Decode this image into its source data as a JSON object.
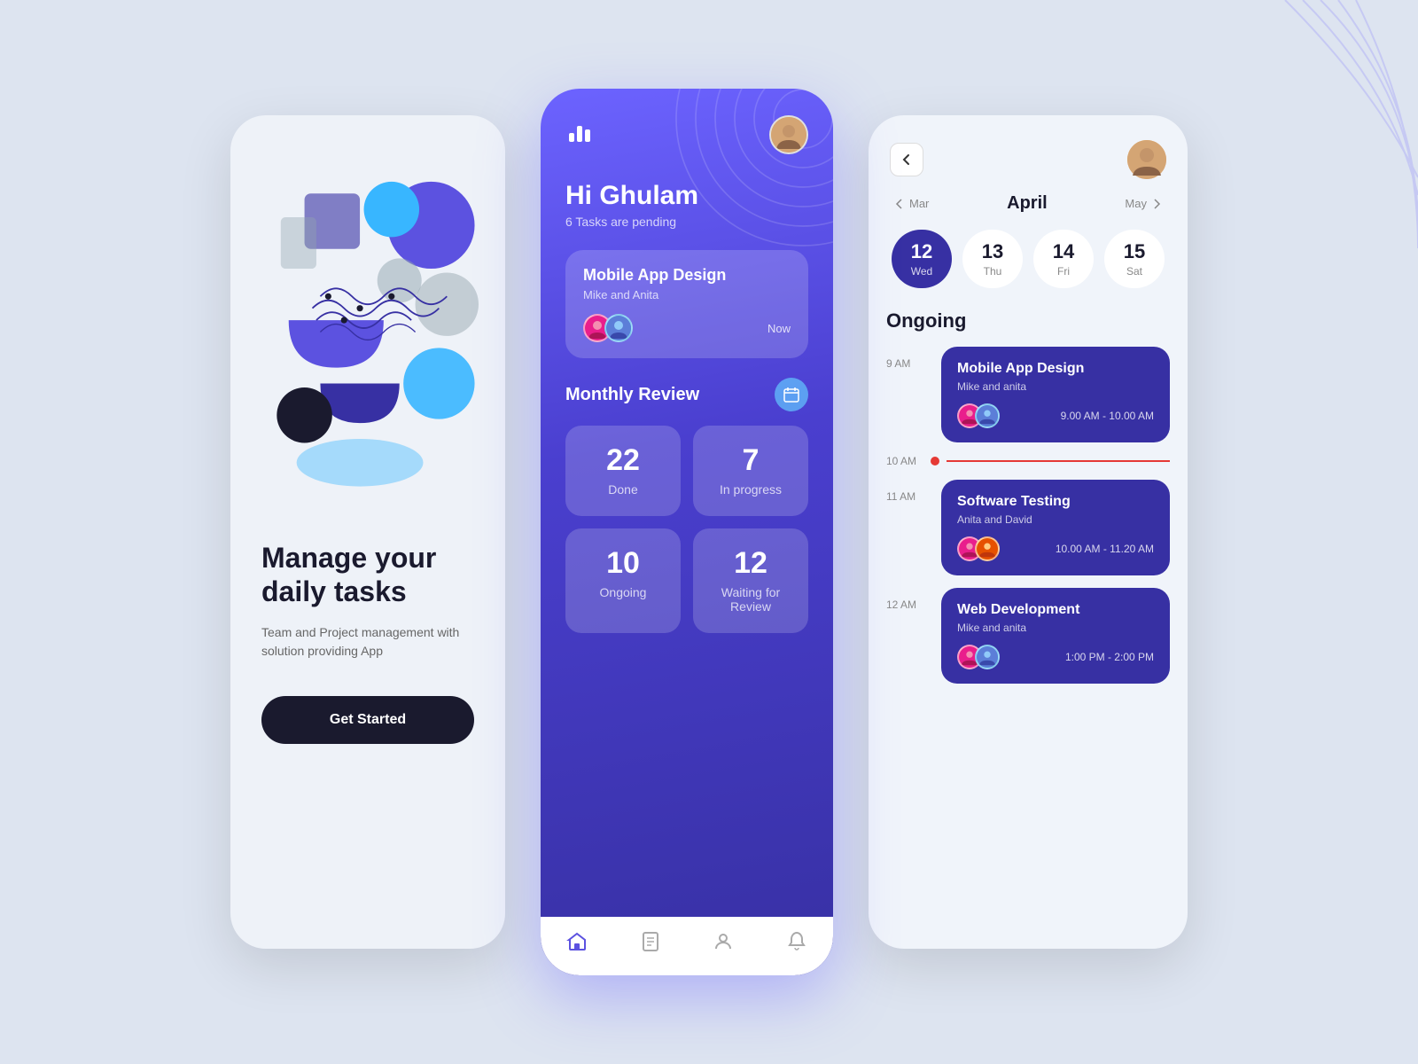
{
  "background": {
    "color": "#dde4f0"
  },
  "screen1": {
    "title_line1": "Manage your",
    "title_line2": "daily tasks",
    "subtitle": "Team and Project management with solution providing App",
    "cta_label": "Get Started"
  },
  "screen2": {
    "logo_icon": "bar-chart",
    "greeting": "Hi Ghulam",
    "tasks_pending": "6 Tasks are pending",
    "task_card": {
      "title": "Mobile App Design",
      "participants": "Mike and Anita",
      "time": "Now"
    },
    "monthly_review": {
      "title": "Monthly Review",
      "stats": [
        {
          "number": "22",
          "label": "Done"
        },
        {
          "number": "7",
          "label": "In progress"
        },
        {
          "number": "10",
          "label": "Ongoing"
        },
        {
          "number": "12",
          "label": "Waiting for Review"
        }
      ]
    },
    "nav_items": [
      "home",
      "document",
      "person",
      "bell"
    ]
  },
  "screen3": {
    "month": "April",
    "prev_month": "Mar",
    "next_month": "May",
    "dates": [
      {
        "num": "12",
        "day": "Wed",
        "active": true
      },
      {
        "num": "13",
        "day": "Thu",
        "active": false
      },
      {
        "num": "14",
        "day": "Fri",
        "active": false
      },
      {
        "num": "15",
        "day": "Sat",
        "active": false
      }
    ],
    "section_title": "Ongoing",
    "events": [
      {
        "time": "9 AM",
        "title": "Mobile App Design",
        "participants": "Mike and anita",
        "time_range": "9.00 AM - 10.00 AM"
      },
      {
        "time": "10 AM",
        "current_time": true
      },
      {
        "time": "11 AM",
        "title": "Software Testing",
        "participants": "Anita and David",
        "time_range": "10.00 AM - 11.20 AM"
      },
      {
        "time": "12 AM",
        "title": "Web Development",
        "participants": "Mike and anita",
        "time_range": "1:00 PM - 2:00 PM"
      }
    ]
  }
}
